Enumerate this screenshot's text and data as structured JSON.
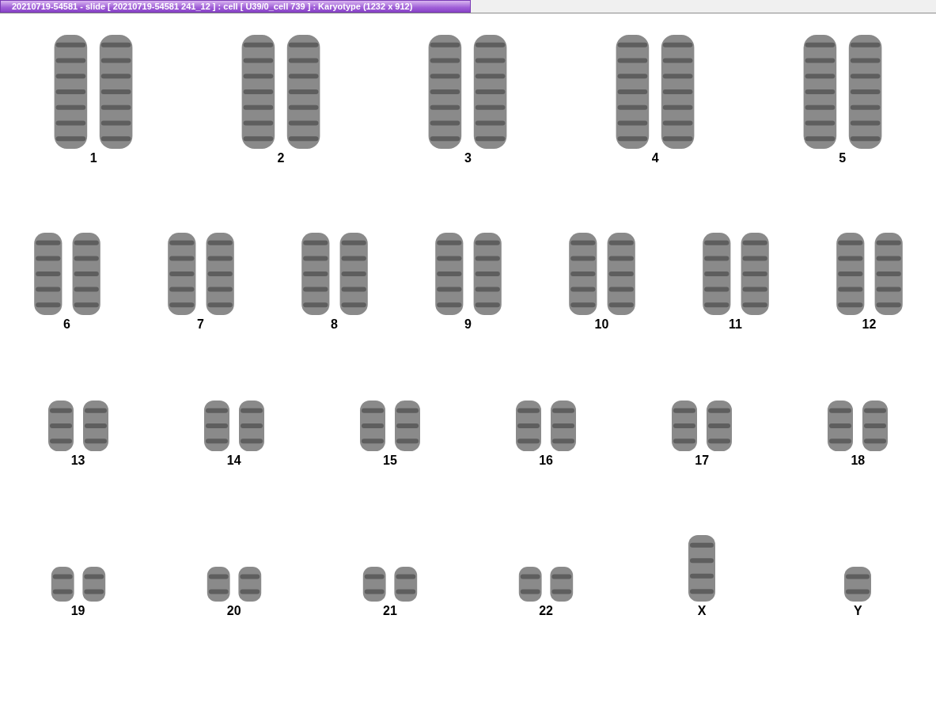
{
  "window": {
    "title": "20210719-54581 - slide [ 20210719-54581 241_12 ] : cell [ U39/0_cell 739 ] : Karyotype  (1232 x 912)"
  },
  "karyotype": {
    "rows": [
      [
        {
          "label": "1",
          "kind": "pair"
        },
        {
          "label": "2",
          "kind": "pair"
        },
        {
          "label": "3",
          "kind": "pair"
        },
        {
          "label": "4",
          "kind": "pair"
        },
        {
          "label": "5",
          "kind": "pair"
        }
      ],
      [
        {
          "label": "6",
          "kind": "pair"
        },
        {
          "label": "7",
          "kind": "pair"
        },
        {
          "label": "8",
          "kind": "pair"
        },
        {
          "label": "9",
          "kind": "pair"
        },
        {
          "label": "10",
          "kind": "pair"
        },
        {
          "label": "11",
          "kind": "pair"
        },
        {
          "label": "12",
          "kind": "pair"
        }
      ],
      [
        {
          "label": "13",
          "kind": "pair"
        },
        {
          "label": "14",
          "kind": "pair"
        },
        {
          "label": "15",
          "kind": "pair"
        },
        {
          "label": "16",
          "kind": "pair"
        },
        {
          "label": "17",
          "kind": "pair"
        },
        {
          "label": "18",
          "kind": "pair"
        }
      ],
      [
        {
          "label": "19",
          "kind": "pair"
        },
        {
          "label": "20",
          "kind": "pair"
        },
        {
          "label": "21",
          "kind": "pair"
        },
        {
          "label": "22",
          "kind": "pair"
        },
        {
          "label": "X",
          "kind": "single"
        },
        {
          "label": "Y",
          "kind": "single"
        }
      ]
    ]
  }
}
